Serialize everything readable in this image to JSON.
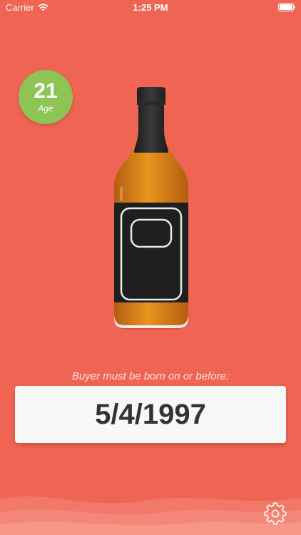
{
  "status_bar": {
    "carrier": "Carrier",
    "time": "1:25 PM"
  },
  "age_badge": {
    "number": "21",
    "label": "Age"
  },
  "prompt": "Buyer must be born on or before:",
  "date": "5/4/1997",
  "icons": {
    "wifi": "wifi-icon",
    "battery": "battery-icon",
    "settings": "gear-icon",
    "bottle": "whiskey-bottle-illustration"
  },
  "colors": {
    "background": "#EF6452",
    "badge": "#8DC454",
    "card": "#F8F8F8",
    "date_text": "#333333"
  }
}
